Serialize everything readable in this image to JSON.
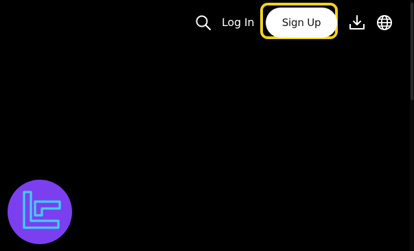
{
  "header": {
    "login_label": "Log In",
    "signup_label": "Sign Up"
  },
  "icons": {
    "search": "search-icon",
    "download": "download-icon",
    "language": "globe-icon",
    "brand": "brand-logo-icon"
  },
  "colors": {
    "background": "#000000",
    "signup_bg": "#ffffff",
    "highlight_border": "#f5d417",
    "logo_bg": "#7c3ff0",
    "logo_mark": "#3fd0f5"
  }
}
